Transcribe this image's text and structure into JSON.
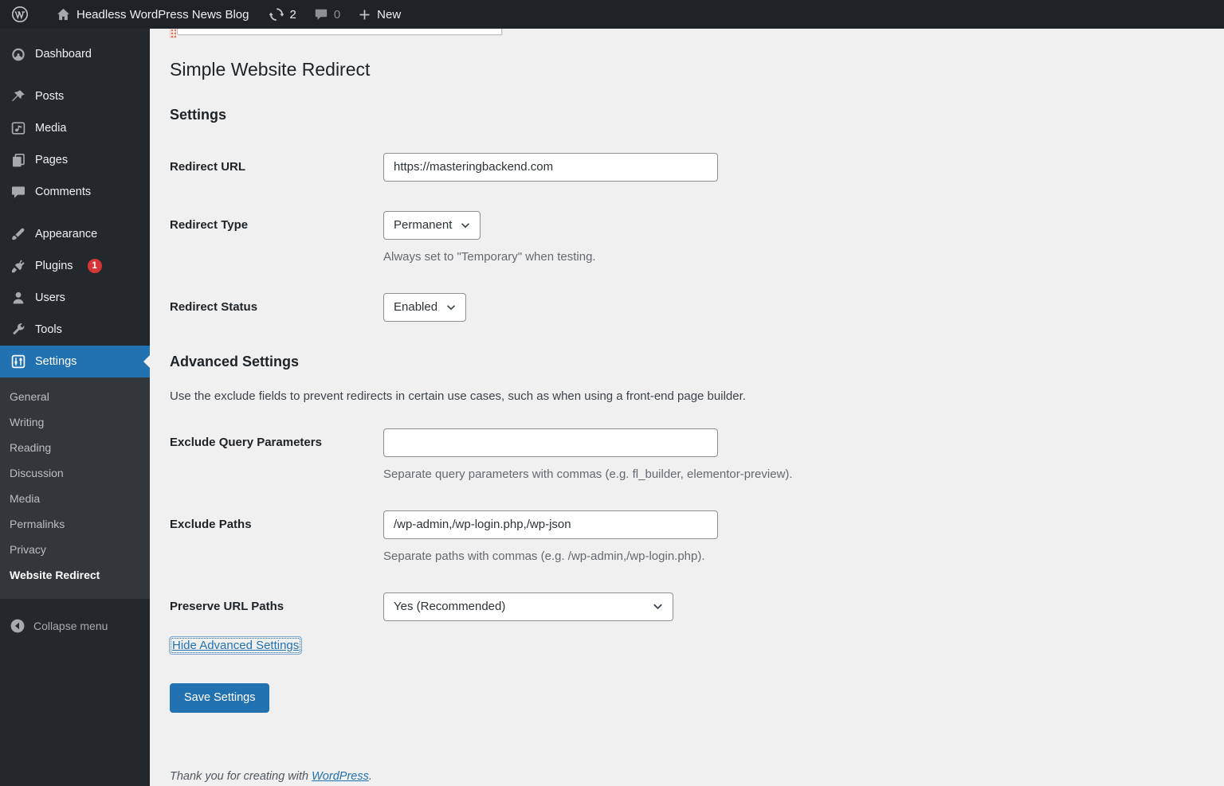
{
  "admin_bar": {
    "site_name": "Headless WordPress News Blog",
    "updates_count": "2",
    "comments_count": "0",
    "new_label": "New"
  },
  "sidebar": {
    "items": [
      {
        "label": "Dashboard"
      },
      {
        "label": "Posts"
      },
      {
        "label": "Media"
      },
      {
        "label": "Pages"
      },
      {
        "label": "Comments"
      },
      {
        "label": "Appearance"
      },
      {
        "label": "Plugins",
        "badge": "1"
      },
      {
        "label": "Users"
      },
      {
        "label": "Tools"
      },
      {
        "label": "Settings"
      }
    ],
    "settings_submenu": [
      {
        "label": "General"
      },
      {
        "label": "Writing"
      },
      {
        "label": "Reading"
      },
      {
        "label": "Discussion"
      },
      {
        "label": "Media"
      },
      {
        "label": "Permalinks"
      },
      {
        "label": "Privacy"
      },
      {
        "label": "Website Redirect"
      }
    ],
    "active_item": "Settings",
    "active_submenu_item": "Website Redirect",
    "collapse_label": "Collapse menu"
  },
  "main": {
    "page_title": "Simple Website Redirect",
    "settings_heading": "Settings",
    "advanced_heading": "Advanced Settings",
    "advanced_description": "Use the exclude fields to prevent redirects in certain use cases, such as when using a front-end page builder.",
    "form": {
      "redirect_url": {
        "label": "Redirect URL",
        "value": "https://masteringbackend.com"
      },
      "redirect_type": {
        "label": "Redirect Type",
        "value": "Permanent",
        "help": "Always set to \"Temporary\" when testing."
      },
      "redirect_status": {
        "label": "Redirect Status",
        "value": "Enabled"
      },
      "exclude_query_parameters": {
        "label": "Exclude Query Parameters",
        "value": "",
        "help": "Separate query parameters with commas (e.g. fl_builder, elementor-preview)."
      },
      "exclude_paths": {
        "label": "Exclude Paths",
        "value": "/wp-admin,/wp-login.php,/wp-json",
        "help": "Separate paths with commas (e.g. /wp-admin,/wp-login.php)."
      },
      "preserve_url_paths": {
        "label": "Preserve URL Paths",
        "value": "Yes (Recommended)"
      },
      "hide_advanced_link": "Hide Advanced Settings",
      "save_button": "Save Settings"
    },
    "footer": {
      "text": "Thank you for creating with ",
      "link": "WordPress",
      "suffix": "."
    }
  },
  "colors": {
    "accent": "#2271b1",
    "badge": "#d63638",
    "adminbar_bg": "#1d2327",
    "sidebar_bg": "#23282d",
    "submenu_bg": "#32373c",
    "content_bg": "#f0f0f1"
  }
}
